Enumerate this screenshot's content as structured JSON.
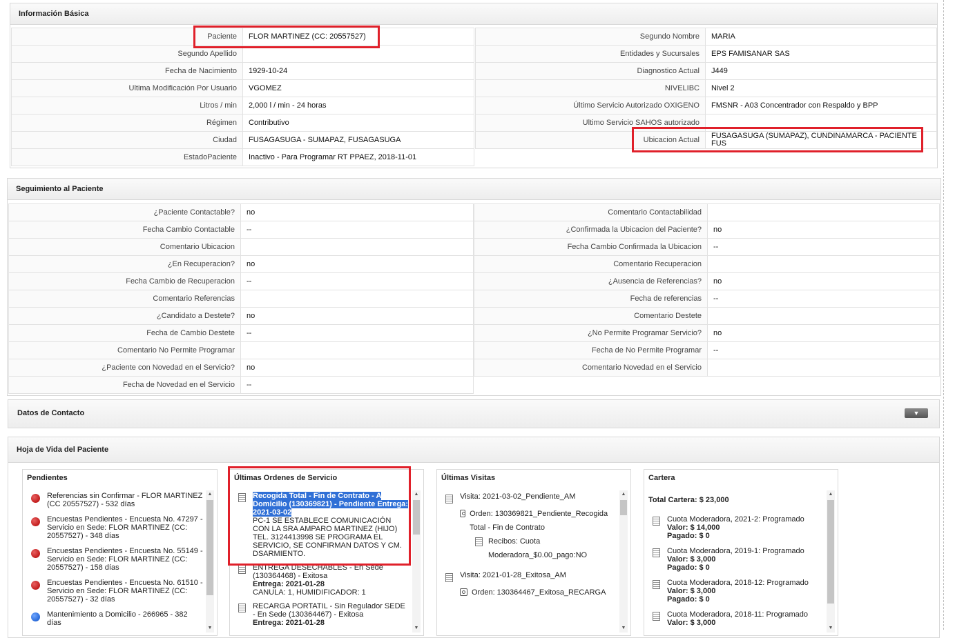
{
  "basic": {
    "title": "Información Básica",
    "left": [
      {
        "label": "Paciente",
        "value": "FLOR MARTINEZ (CC: 20557527)"
      },
      {
        "label": "Segundo Apellido",
        "value": ""
      },
      {
        "label": "Fecha de Nacimiento",
        "value": "1929-10-24"
      },
      {
        "label": "Ultima Modificación Por Usuario",
        "value": "VGOMEZ"
      },
      {
        "label": "Litros / min",
        "value": "2,000 l / min - 24 horas"
      },
      {
        "label": "Régimen",
        "value": "Contributivo"
      },
      {
        "label": "Ciudad",
        "value": "FUSAGASUGA - SUMAPAZ, FUSAGASUGA"
      },
      {
        "label": "EstadoPaciente",
        "value": "Inactivo - Para Programar RT PPAEZ, 2018-11-01"
      }
    ],
    "right": [
      {
        "label": "Segundo Nombre",
        "value": "MARIA"
      },
      {
        "label": "Entidades y Sucursales",
        "value": "EPS FAMISANAR SAS"
      },
      {
        "label": "Diagnostico Actual",
        "value": "J449"
      },
      {
        "label": "NIVELIBC",
        "value": "Nivel 2"
      },
      {
        "label": "Último Servicio Autorizado OXIGENO",
        "value": "FMSNR - A03 Concentrador con Respaldo y BPP"
      },
      {
        "label": "Ultimo Servicio SAHOS autorizado",
        "value": ""
      },
      {
        "label": "Ubicacion Actual",
        "value": "FUSAGASUGA (SUMAPAZ), CUNDINAMARCA - PACIENTE FUS"
      }
    ]
  },
  "seguimiento": {
    "title": "Seguimiento al Paciente",
    "left": [
      {
        "label": "¿Paciente Contactable?",
        "value": "no"
      },
      {
        "label": "Fecha Cambio Contactable",
        "value": "--"
      },
      {
        "label": "Comentario Ubicacion",
        "value": ""
      },
      {
        "label": "¿En Recuperacion?",
        "value": "no"
      },
      {
        "label": "Fecha Cambio de Recuperacion",
        "value": "--"
      },
      {
        "label": "Comentario Referencias",
        "value": ""
      },
      {
        "label": "¿Candidato a Destete?",
        "value": "no"
      },
      {
        "label": "Fecha de Cambio Destete",
        "value": "--"
      },
      {
        "label": "Comentario No Permite Programar",
        "value": ""
      },
      {
        "label": "¿Paciente con Novedad en el Servicio?",
        "value": "no"
      },
      {
        "label": "Fecha de Novedad en el Servicio",
        "value": "--"
      }
    ],
    "right": [
      {
        "label": "Comentario Contactabilidad",
        "value": ""
      },
      {
        "label": "¿Confirmada la Ubicacion del Paciente?",
        "value": "no"
      },
      {
        "label": "Fecha Cambio Confirmada la Ubicacion",
        "value": "--"
      },
      {
        "label": "Comentario Recuperacion",
        "value": ""
      },
      {
        "label": "¿Ausencia de Referencias?",
        "value": "no"
      },
      {
        "label": "Fecha de referencias",
        "value": "--"
      },
      {
        "label": "Comentario Destete",
        "value": ""
      },
      {
        "label": "¿No Permite Programar Servicio?",
        "value": "no"
      },
      {
        "label": "Fecha de No Permite Programar",
        "value": "--"
      },
      {
        "label": "Comentario Novedad en el Servicio",
        "value": ""
      }
    ]
  },
  "contacto": {
    "title": "Datos de Contacto",
    "toggle_icon": "▼"
  },
  "hoja": {
    "title": "Hoja de Vida del Paciente",
    "pendientes": {
      "title": "Pendientes",
      "items": [
        {
          "text": "Referencias sin Confirmar - FLOR MARTINEZ (CC 20557527) - 532 días",
          "color": "red"
        },
        {
          "text": "Encuestas Pendientes - Encuesta No. 47297 - Servicio en Sede: FLOR MARTINEZ (CC: 20557527) - 348 días",
          "color": "red"
        },
        {
          "text": "Encuestas Pendientes - Encuesta No. 55149 - Servicio en Sede: FLOR MARTINEZ (CC: 20557527) - 158 días",
          "color": "red"
        },
        {
          "text": "Encuestas Pendientes - Encuesta No. 61510 - Servicio en Sede: FLOR MARTINEZ (CC: 20557527) - 32 días",
          "color": "red"
        },
        {
          "text": "Mantenimiento a Domicilio - 266965 - 382 días",
          "color": "blue"
        }
      ]
    },
    "ordenes": {
      "title": "Últimas Ordenes de Servicio",
      "o1_highlight": "Recogida Total - Fin de Contrato - A Domicilio (130369821) - Pendiente Entrega: 2021-03-02",
      "o1_desc": "PC-1 SE ESTABLECE COMUNICACIÓN CON LA SRA AMPARO MARTINEZ (HIJO) TEL. 3124413998 SE PROGRAMA EL SERVICIO, SE CONFIRMAN DATOS Y CM. DSARMIENTO.",
      "o2_title": "ENTREGA DESECHABLES - En Sede (130364468) - Exitosa",
      "o2_entrega": "Entrega: 2021-01-28",
      "o2_desc": "CANULA: 1, HUMIDIFICADOR: 1",
      "o3_title": "RECARGA PORTATIL - Sin Regulador SEDE - En Sede (130364467) - Exitosa",
      "o3_entrega": "Entrega: 2021-01-28"
    },
    "visitas": {
      "title": "Últimas Visitas",
      "v1": "Visita: 2021-03-02_Pendiente_AM",
      "v1_orden": "Orden: 130369821_Pendiente_Recogida Total - Fin de Contrato",
      "v1_recibos": "Recibos: Cuota Moderadora_$0.00_pago:NO",
      "v2": "Visita: 2021-01-28_Exitosa_AM",
      "v2_orden": "Orden: 130364467_Exitosa_RECARGA"
    },
    "cartera": {
      "title": "Cartera",
      "total": "Total Cartera: $ 23,000",
      "items": [
        {
          "title": "Cuota Moderadora, 2021-2: Programado",
          "valor": "Valor: $ 14,000",
          "pagado": "Pagado: $ 0"
        },
        {
          "title": "Cuota Moderadora, 2019-1: Programado",
          "valor": "Valor: $ 3,000",
          "pagado": "Pagado: $ 0"
        },
        {
          "title": "Cuota Moderadora, 2018-12: Programado",
          "valor": "Valor: $ 3,000",
          "pagado": "Pagado: $ 0"
        },
        {
          "title": "Cuota Moderadora, 2018-11: Programado",
          "valor": "Valor: $ 3,000",
          "pagado": ""
        }
      ]
    }
  }
}
